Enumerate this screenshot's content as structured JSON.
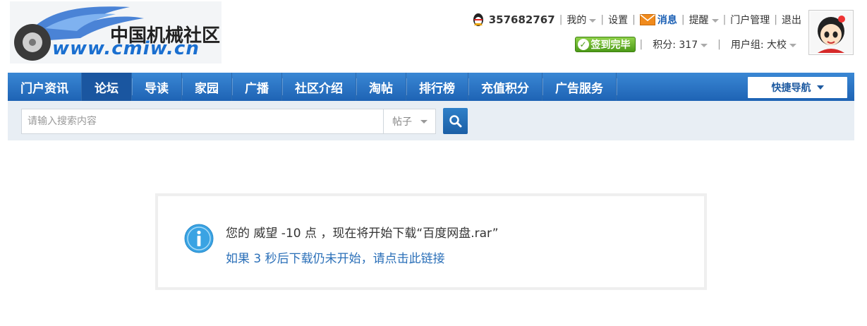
{
  "header": {
    "logo_cn": "中国机械社区",
    "logo_url": "www.cmiw.cn",
    "user": {
      "uid": "357682767",
      "mine": "我的",
      "settings": "设置",
      "messages": "消息",
      "reminders": "提醒",
      "portal_admin": "门户管理",
      "logout": "退出",
      "signed_in": "签到完毕",
      "points_label": "积分: 317",
      "usergroup_label": "用户组: 大校"
    }
  },
  "nav": {
    "items": [
      "门户资讯",
      "论坛",
      "导读",
      "家园",
      "广播",
      "社区介绍",
      "淘帖",
      "排行榜",
      "充值积分",
      "广告服务"
    ],
    "active_index": 1,
    "quick_nav": "快捷导航"
  },
  "search": {
    "placeholder": "请输入搜索内容",
    "type": "帖子"
  },
  "message": {
    "line1": "您的 威望 -10 点 ，现在将开始下载“百度网盘.rar”",
    "line2": "如果 3 秒后下载仍未开始，请点击此链接"
  },
  "colors": {
    "nav_bg": "#2a74c6",
    "link": "#2a6fb8",
    "search_bg": "#e8eef4"
  }
}
